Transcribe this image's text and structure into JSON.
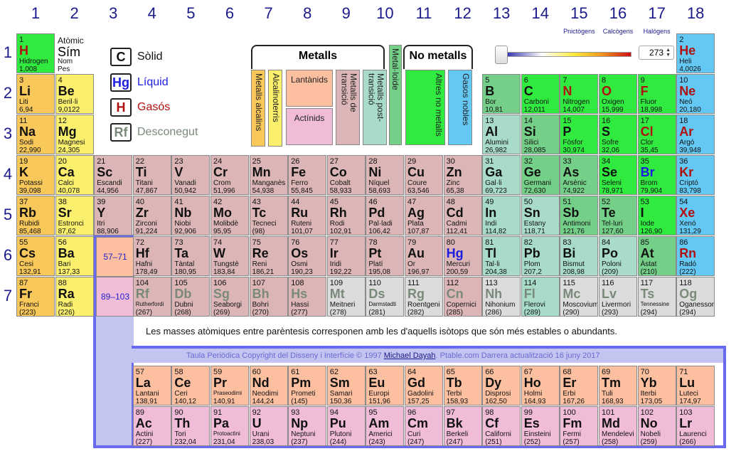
{
  "group_numbers": [
    "1",
    "2",
    "3",
    "4",
    "5",
    "6",
    "7",
    "8",
    "9",
    "10",
    "11",
    "12",
    "13",
    "14",
    "15",
    "16",
    "17",
    "18"
  ],
  "group_subtitles": {
    "15": "Pnictògens",
    "16": "Calcògens",
    "17": "Halògens"
  },
  "period_numbers": [
    "1",
    "2",
    "3",
    "4",
    "5",
    "6",
    "7"
  ],
  "key_cell": {
    "number": "Atòmic",
    "symbol": "Sím",
    "name": "Nom",
    "weight": "Pes"
  },
  "legend": [
    {
      "symbol": "C",
      "label": "Sòlid",
      "color": "#111111"
    },
    {
      "symbol": "Hg",
      "label": "Líquid",
      "color": "#1d1de0"
    },
    {
      "symbol": "H",
      "label": "Gasós",
      "color": "#b01010"
    },
    {
      "symbol": "Rf",
      "label": "Desconegut",
      "color": "#7a8a7a"
    }
  ],
  "categories": {
    "metals_title": "Metalls",
    "nonmetals_title": "No metalls",
    "alkali": "Metalls alcalins",
    "alkaline_earth": "Alcalinoterris",
    "lanthanides": "Lantànids",
    "actinides": "Actínids",
    "transition": "Metalls de transició",
    "post_transition": "Metalls post-transició",
    "metalloid": "Metal·loide",
    "other_nonmetals": "Altres no metalls",
    "noble_gases": "Gasos nobles"
  },
  "temperature": {
    "value": "273"
  },
  "series_ranges": {
    "lanthanides": "57–71",
    "actinides": "89–103"
  },
  "footnote": "Les masses atòmiques entre parèntesis corresponen amb les d'aquells isòtops que són més estables o abundants.",
  "copyright": {
    "text": "Taula Periòdica Copyright del Disseny i Interfície © 1997 ",
    "author": "Michael Dayah",
    "rest": ". Ptable.com Darrera actualització 16 juny 2017"
  },
  "colors": {
    "alkali": "#f8c85a",
    "alkaline": "#fbf06e",
    "transition": "#dcb6b6",
    "post": "#a8dcc8",
    "metalloid": "#74d088",
    "nonmetal": "#30ea40",
    "noble": "#64c8f4",
    "lanth": "#fcc0a0",
    "act": "#f0bcd8",
    "unknown": "#dcdcdc",
    "hydrogen": "#30ea40"
  },
  "elements": [
    [
      "1",
      "H",
      "Hidrogen",
      "1,008",
      1,
      1,
      "g",
      "hydrogen"
    ],
    [
      "2",
      "He",
      "Heli",
      "4,0026",
      18,
      1,
      "g",
      "noble"
    ],
    [
      "3",
      "Li",
      "Liti",
      "6,94",
      1,
      2,
      "c",
      "alkali"
    ],
    [
      "4",
      "Be",
      "Beril·li",
      "9,0122",
      2,
      2,
      "c",
      "alkaline"
    ],
    [
      "5",
      "B",
      "Bor",
      "10,81",
      13,
      2,
      "c",
      "metalloid"
    ],
    [
      "6",
      "C",
      "Carboni",
      "12,011",
      14,
      2,
      "c",
      "nonmetal"
    ],
    [
      "7",
      "N",
      "Nitrogen",
      "14,007",
      15,
      2,
      "g",
      "nonmetal"
    ],
    [
      "8",
      "O",
      "Oxigen",
      "15,999",
      16,
      2,
      "g",
      "nonmetal"
    ],
    [
      "9",
      "F",
      "Fluor",
      "18,998",
      17,
      2,
      "g",
      "nonmetal"
    ],
    [
      "10",
      "Ne",
      "Neó",
      "20,180",
      18,
      2,
      "g",
      "noble"
    ],
    [
      "11",
      "Na",
      "Sodi",
      "22,990",
      1,
      3,
      "c",
      "alkali"
    ],
    [
      "12",
      "Mg",
      "Magnesi",
      "24,305",
      2,
      3,
      "c",
      "alkaline"
    ],
    [
      "13",
      "Al",
      "Alumini",
      "26,982",
      13,
      3,
      "c",
      "post"
    ],
    [
      "14",
      "Si",
      "Silici",
      "28,085",
      14,
      3,
      "c",
      "metalloid"
    ],
    [
      "15",
      "P",
      "Fòsfor",
      "30,974",
      15,
      3,
      "c",
      "nonmetal"
    ],
    [
      "16",
      "S",
      "Sofre",
      "32,06",
      16,
      3,
      "c",
      "nonmetal"
    ],
    [
      "17",
      "Cl",
      "Clor",
      "35,45",
      17,
      3,
      "g",
      "nonmetal"
    ],
    [
      "18",
      "Ar",
      "Argó",
      "39,948",
      18,
      3,
      "g",
      "noble"
    ],
    [
      "19",
      "K",
      "Potassi",
      "39,098",
      1,
      4,
      "c",
      "alkali"
    ],
    [
      "20",
      "Ca",
      "Calci",
      "40,078",
      2,
      4,
      "c",
      "alkaline"
    ],
    [
      "21",
      "Sc",
      "Escandi",
      "44,956",
      3,
      4,
      "c",
      "transition"
    ],
    [
      "22",
      "Ti",
      "Titani",
      "47,867",
      4,
      4,
      "c",
      "transition"
    ],
    [
      "23",
      "V",
      "Vanadi",
      "50,942",
      5,
      4,
      "c",
      "transition"
    ],
    [
      "24",
      "Cr",
      "Crom",
      "51,996",
      6,
      4,
      "c",
      "transition"
    ],
    [
      "25",
      "Mn",
      "Manganès",
      "54,938",
      7,
      4,
      "c",
      "transition"
    ],
    [
      "26",
      "Fe",
      "Ferro",
      "55,845",
      8,
      4,
      "c",
      "transition"
    ],
    [
      "27",
      "Co",
      "Cobalt",
      "58,933",
      9,
      4,
      "c",
      "transition"
    ],
    [
      "28",
      "Ni",
      "Níquel",
      "58,693",
      10,
      4,
      "c",
      "transition"
    ],
    [
      "29",
      "Cu",
      "Coure",
      "63,546",
      11,
      4,
      "c",
      "transition"
    ],
    [
      "30",
      "Zn",
      "Zinc",
      "65,38",
      12,
      4,
      "c",
      "transition"
    ],
    [
      "31",
      "Ga",
      "Gal·li",
      "69,723",
      13,
      4,
      "c",
      "post"
    ],
    [
      "32",
      "Ge",
      "Germani",
      "72,630",
      14,
      4,
      "c",
      "metalloid"
    ],
    [
      "33",
      "As",
      "Arsènic",
      "74,922",
      15,
      4,
      "c",
      "metalloid"
    ],
    [
      "34",
      "Se",
      "Seleni",
      "78,971",
      16,
      4,
      "c",
      "nonmetal"
    ],
    [
      "35",
      "Br",
      "Brom",
      "79,904",
      17,
      4,
      "l",
      "nonmetal"
    ],
    [
      "36",
      "Kr",
      "Criptó",
      "83,798",
      18,
      4,
      "g",
      "noble"
    ],
    [
      "37",
      "Rb",
      "Rubidi",
      "85,468",
      1,
      5,
      "c",
      "alkali"
    ],
    [
      "38",
      "Sr",
      "Estronci",
      "87,62",
      2,
      5,
      "c",
      "alkaline"
    ],
    [
      "39",
      "Y",
      "Itri",
      "88,906",
      3,
      5,
      "c",
      "transition"
    ],
    [
      "40",
      "Zr",
      "Zirconi",
      "91,224",
      4,
      5,
      "c",
      "transition"
    ],
    [
      "41",
      "Nb",
      "Niobi",
      "92,906",
      5,
      5,
      "c",
      "transition"
    ],
    [
      "42",
      "Mo",
      "Molibdè",
      "95,95",
      6,
      5,
      "c",
      "transition"
    ],
    [
      "43",
      "Tc",
      "Tecneci",
      "(98)",
      7,
      5,
      "c",
      "transition"
    ],
    [
      "44",
      "Ru",
      "Ruteni",
      "101,07",
      8,
      5,
      "c",
      "transition"
    ],
    [
      "45",
      "Rh",
      "Rodi",
      "102,91",
      9,
      5,
      "c",
      "transition"
    ],
    [
      "46",
      "Pd",
      "Pal·ladi",
      "106,42",
      10,
      5,
      "c",
      "transition"
    ],
    [
      "47",
      "Ag",
      "Plata",
      "107,87",
      11,
      5,
      "c",
      "transition"
    ],
    [
      "48",
      "Cd",
      "Cadmi",
      "112,41",
      12,
      5,
      "c",
      "transition"
    ],
    [
      "49",
      "In",
      "Indi",
      "114,82",
      13,
      5,
      "c",
      "post"
    ],
    [
      "50",
      "Sn",
      "Estany",
      "118,71",
      14,
      5,
      "c",
      "post"
    ],
    [
      "51",
      "Sb",
      "Antimoni",
      "121,76",
      15,
      5,
      "c",
      "metalloid"
    ],
    [
      "52",
      "Te",
      "Tel·luri",
      "127,60",
      16,
      5,
      "c",
      "metalloid"
    ],
    [
      "53",
      "I",
      "Iode",
      "126,90",
      17,
      5,
      "c",
      "nonmetal"
    ],
    [
      "54",
      "Xe",
      "Xenó",
      "131,29",
      18,
      5,
      "g",
      "noble"
    ],
    [
      "55",
      "Cs",
      "Cesi",
      "132,91",
      1,
      6,
      "c",
      "alkali"
    ],
    [
      "56",
      "Ba",
      "Bari",
      "137,33",
      2,
      6,
      "c",
      "alkaline"
    ],
    [
      "72",
      "Hf",
      "Hafni",
      "178,49",
      4,
      6,
      "c",
      "transition"
    ],
    [
      "73",
      "Ta",
      "Tàntal",
      "180,95",
      5,
      6,
      "c",
      "transition"
    ],
    [
      "74",
      "W",
      "Tungstè",
      "183,84",
      6,
      6,
      "c",
      "transition"
    ],
    [
      "75",
      "Re",
      "Reni",
      "186,21",
      7,
      6,
      "c",
      "transition"
    ],
    [
      "76",
      "Os",
      "Osmi",
      "190,23",
      8,
      6,
      "c",
      "transition"
    ],
    [
      "77",
      "Ir",
      "Iridi",
      "192,22",
      9,
      6,
      "c",
      "transition"
    ],
    [
      "78",
      "Pt",
      "Platí",
      "195,08",
      10,
      6,
      "c",
      "transition"
    ],
    [
      "79",
      "Au",
      "Or",
      "196,97",
      11,
      6,
      "c",
      "transition"
    ],
    [
      "80",
      "Hg",
      "Mercuri",
      "200,59",
      12,
      6,
      "l",
      "transition"
    ],
    [
      "81",
      "Tl",
      "Tal·li",
      "204,38",
      13,
      6,
      "c",
      "post"
    ],
    [
      "82",
      "Pb",
      "Plom",
      "207,2",
      14,
      6,
      "c",
      "post"
    ],
    [
      "83",
      "Bi",
      "Bismut",
      "208,98",
      15,
      6,
      "c",
      "post"
    ],
    [
      "84",
      "Po",
      "Poloni",
      "(209)",
      16,
      6,
      "c",
      "post"
    ],
    [
      "85",
      "At",
      "Àstat",
      "(210)",
      17,
      6,
      "c",
      "metalloid"
    ],
    [
      "86",
      "Rn",
      "Radó",
      "(222)",
      18,
      6,
      "g",
      "noble"
    ],
    [
      "87",
      "Fr",
      "Franci",
      "(223)",
      1,
      7,
      "c",
      "alkali"
    ],
    [
      "88",
      "Ra",
      "Radi",
      "(226)",
      2,
      7,
      "c",
      "alkaline"
    ],
    [
      "104",
      "Rf",
      "Rutherfordi",
      "(267)",
      4,
      7,
      "u",
      "transition"
    ],
    [
      "105",
      "Db",
      "Dubni",
      "(268)",
      5,
      7,
      "u",
      "transition"
    ],
    [
      "106",
      "Sg",
      "Seaborgi",
      "(269)",
      6,
      7,
      "u",
      "transition"
    ],
    [
      "107",
      "Bh",
      "Bohri",
      "(270)",
      7,
      7,
      "u",
      "transition"
    ],
    [
      "108",
      "Hs",
      "Hassi",
      "(277)",
      8,
      7,
      "u",
      "transition"
    ],
    [
      "109",
      "Mt",
      "Meitneri",
      "(278)",
      9,
      7,
      "u",
      "unknown"
    ],
    [
      "110",
      "Ds",
      "Darmstadti",
      "(281)",
      10,
      7,
      "u",
      "unknown"
    ],
    [
      "111",
      "Rg",
      "Roentgeni",
      "(282)",
      11,
      7,
      "u",
      "unknown"
    ],
    [
      "112",
      "Cn",
      "Copernici",
      "(285)",
      12,
      7,
      "u",
      "transition"
    ],
    [
      "113",
      "Nh",
      "Nihonium",
      "(286)",
      13,
      7,
      "u",
      "unknown"
    ],
    [
      "114",
      "Fl",
      "Flerovi",
      "(289)",
      14,
      7,
      "u",
      "post"
    ],
    [
      "115",
      "Mc",
      "Moscovium",
      "(290)",
      15,
      7,
      "u",
      "unknown"
    ],
    [
      "116",
      "Lv",
      "Livermori",
      "(293)",
      16,
      7,
      "u",
      "unknown"
    ],
    [
      "117",
      "Ts",
      "Tennessine",
      "(294)",
      17,
      7,
      "u",
      "unknown"
    ],
    [
      "118",
      "Og",
      "Oganesson",
      "(294)",
      18,
      7,
      "u",
      "unknown"
    ],
    [
      "57",
      "La",
      "Lantani",
      "138,91",
      4,
      9,
      "c",
      "lanth"
    ],
    [
      "58",
      "Ce",
      "Ceri",
      "140,12",
      5,
      9,
      "c",
      "lanth"
    ],
    [
      "59",
      "Pr",
      "Praseodimi",
      "140,91",
      6,
      9,
      "c",
      "lanth"
    ],
    [
      "60",
      "Nd",
      "Neodimi",
      "144,24",
      7,
      9,
      "c",
      "lanth"
    ],
    [
      "61",
      "Pm",
      "Prometi",
      "(145)",
      8,
      9,
      "c",
      "lanth"
    ],
    [
      "62",
      "Sm",
      "Samari",
      "150,36",
      9,
      9,
      "c",
      "lanth"
    ],
    [
      "63",
      "Eu",
      "Europi",
      "151,96",
      10,
      9,
      "c",
      "lanth"
    ],
    [
      "64",
      "Gd",
      "Gadolini",
      "157,25",
      11,
      9,
      "c",
      "lanth"
    ],
    [
      "65",
      "Tb",
      "Terbi",
      "158,93",
      12,
      9,
      "c",
      "lanth"
    ],
    [
      "66",
      "Dy",
      "Disprosi",
      "162,50",
      13,
      9,
      "c",
      "lanth"
    ],
    [
      "67",
      "Ho",
      "Holmi",
      "164,93",
      14,
      9,
      "c",
      "lanth"
    ],
    [
      "68",
      "Er",
      "Erbi",
      "167,26",
      15,
      9,
      "c",
      "lanth"
    ],
    [
      "69",
      "Tm",
      "Tuli",
      "168,93",
      16,
      9,
      "c",
      "lanth"
    ],
    [
      "70",
      "Yb",
      "Iterbi",
      "173,05",
      17,
      9,
      "c",
      "lanth"
    ],
    [
      "71",
      "Lu",
      "Luteci",
      "174,97",
      18,
      9,
      "c",
      "lanth"
    ],
    [
      "89",
      "Ac",
      "Actini",
      "(227)",
      4,
      10,
      "c",
      "act"
    ],
    [
      "90",
      "Th",
      "Tori",
      "232,04",
      5,
      10,
      "c",
      "act"
    ],
    [
      "91",
      "Pa",
      "Protoactini",
      "231,04",
      6,
      10,
      "c",
      "act"
    ],
    [
      "92",
      "U",
      "Urani",
      "238,03",
      7,
      10,
      "c",
      "act"
    ],
    [
      "93",
      "Np",
      "Neptuni",
      "(237)",
      8,
      10,
      "c",
      "act"
    ],
    [
      "94",
      "Pu",
      "Plutoni",
      "(244)",
      9,
      10,
      "c",
      "act"
    ],
    [
      "95",
      "Am",
      "Americi",
      "(243)",
      10,
      10,
      "c",
      "act"
    ],
    [
      "96",
      "Cm",
      "Curi",
      "(247)",
      11,
      10,
      "c",
      "act"
    ],
    [
      "97",
      "Bk",
      "Berkeli",
      "(247)",
      12,
      10,
      "c",
      "act"
    ],
    [
      "98",
      "Cf",
      "Californi",
      "(251)",
      13,
      10,
      "c",
      "act"
    ],
    [
      "99",
      "Es",
      "Einsteini",
      "(252)",
      14,
      10,
      "c",
      "act"
    ],
    [
      "100",
      "Fm",
      "Fermi",
      "(257)",
      15,
      10,
      "c",
      "act"
    ],
    [
      "101",
      "Md",
      "Mendelevi",
      "(258)",
      16,
      10,
      "c",
      "act"
    ],
    [
      "102",
      "No",
      "Nobeli",
      "(259)",
      17,
      10,
      "c",
      "act"
    ],
    [
      "103",
      "Lr",
      "Laurenci",
      "(266)",
      18,
      10,
      "c",
      "act"
    ]
  ]
}
